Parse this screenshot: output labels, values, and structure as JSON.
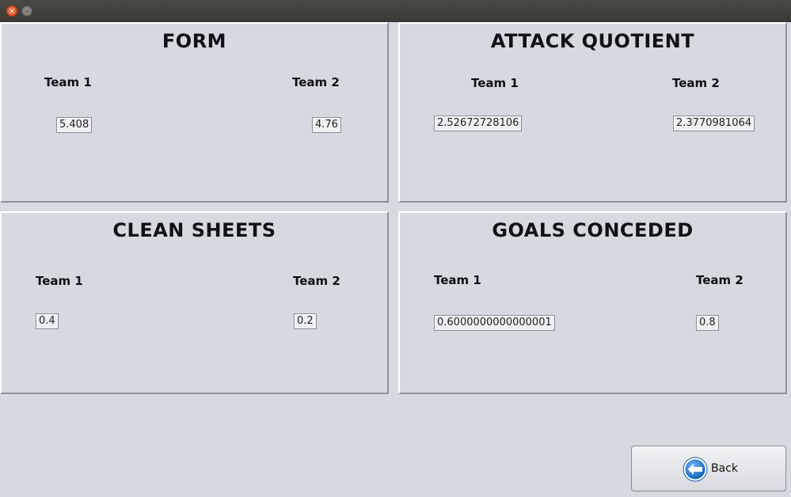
{
  "window": {
    "close_glyph": "×",
    "minimize_glyph": "–"
  },
  "panels": {
    "form": {
      "title": "FORM",
      "team1_label": "Team 1",
      "team2_label": "Team 2",
      "team1_value": "5.408",
      "team2_value": "4.76"
    },
    "attack": {
      "title": "ATTACK QUOTIENT",
      "team1_label": "Team 1",
      "team2_label": "Team 2",
      "team1_value": "2.52672728106",
      "team2_value": "2.3770981064"
    },
    "clean": {
      "title": "CLEAN SHEETS",
      "team1_label": "Team 1",
      "team2_label": "Team 2",
      "team1_value": "0.4",
      "team2_value": "0.2"
    },
    "conceded": {
      "title": "GOALS CONCEDED",
      "team1_label": "Team 1",
      "team2_label": "Team 2",
      "team1_value": "0.6000000000000001",
      "team2_value": "0.8"
    }
  },
  "back_button": {
    "label": "Back",
    "icon": "back-arrow-icon",
    "accent": "#1e7fd8"
  }
}
